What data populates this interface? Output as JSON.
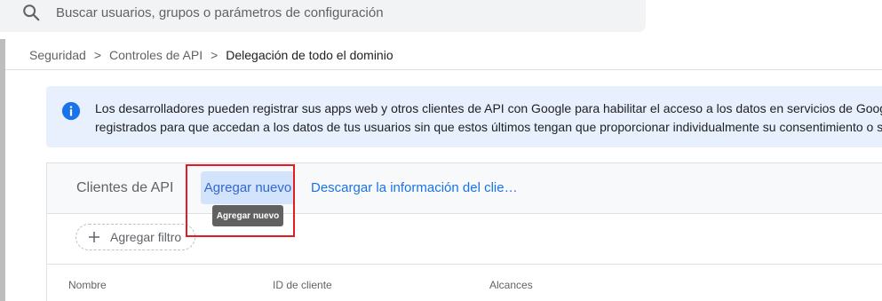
{
  "search": {
    "placeholder": "Buscar usuarios, grupos o parámetros de configuración"
  },
  "breadcrumb": {
    "items": [
      "Seguridad",
      "Controles de API"
    ],
    "current": "Delegación de todo el dominio",
    "separator": ">"
  },
  "banner": {
    "line1": "Los desarrolladores pueden registrar sus apps web y otros clientes de API con Google para habilitar el acceso a los datos en servicios de Goog",
    "line2": "registrados para que accedan a los datos de tus usuarios sin que estos últimos tengan que proporcionar individualmente su consentimiento o s"
  },
  "card": {
    "title": "Clientes de API",
    "add_button": "Agregar nuevo",
    "download_link": "Descargar la información del clie…",
    "tooltip": "Agregar nuevo",
    "filter_label": "Agregar filtro",
    "columns": [
      "Nombre",
      "ID de cliente",
      "Alcances"
    ]
  },
  "colors": {
    "accent": "#1a73e8",
    "banner_bg": "#e8f0fe",
    "highlight": "#e31b23"
  },
  "icons": [
    "search-icon",
    "info-icon",
    "plus-icon"
  ]
}
